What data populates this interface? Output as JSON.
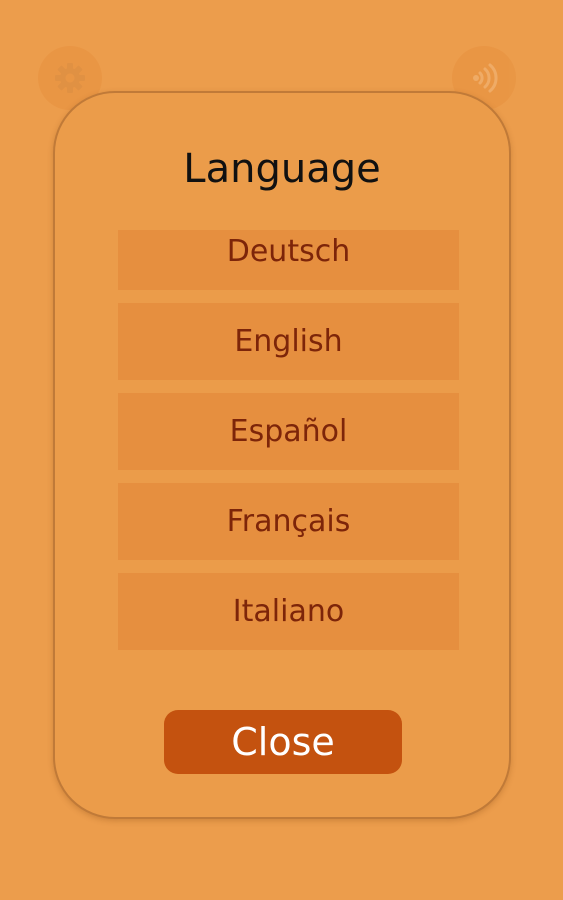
{
  "top_bar": {
    "settings_icon": "gear-icon",
    "sound_icon": "speaker-icon"
  },
  "dialog": {
    "title": "Language",
    "languages": [
      {
        "label": "Deutsch"
      },
      {
        "label": "English"
      },
      {
        "label": "Español"
      },
      {
        "label": "Français"
      },
      {
        "label": "Italiano"
      }
    ],
    "close_label": "Close"
  },
  "colors": {
    "background": "#ec9d4c",
    "dialog": "#eb9c4a",
    "list_item": "#e68f3f",
    "list_text": "#7d2509",
    "close_button": "#c4520f"
  }
}
